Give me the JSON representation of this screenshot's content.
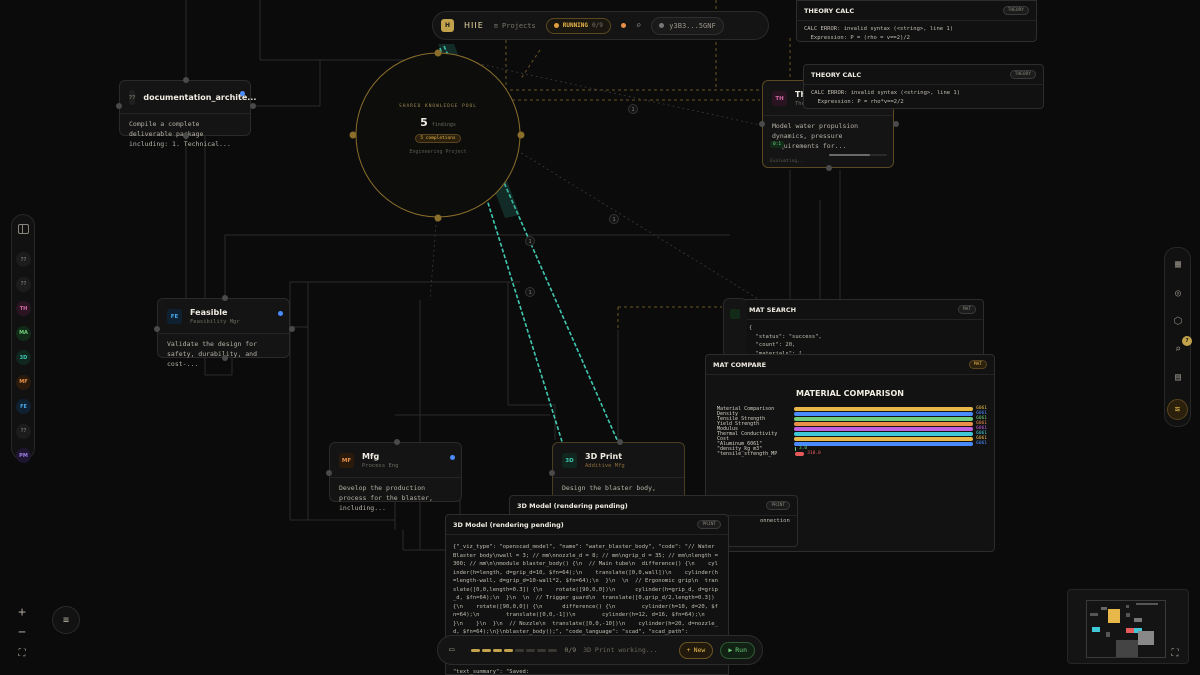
{
  "topbar": {
    "logo_letter": "H",
    "app_name": "HIIE",
    "projects_label": "Projects",
    "status_label": "RUNNING",
    "status_count": "0/9",
    "user_label": "y3B3...5GNF"
  },
  "pool": {
    "heading": "SHARED KNOWLEDGE POOL",
    "count": "5",
    "count_label": "findings",
    "completions": "5 completions",
    "project": "Engineering Project"
  },
  "nodes": {
    "documentation": {
      "badge": "??",
      "title": "documentation_archite...",
      "body": "Compile a complete deliverable package including: 1. Technical..."
    },
    "feasible": {
      "badge": "FE",
      "title": "Feasible",
      "subtitle": "Feasibility Mgr",
      "body": "Validate the design for safety, durability, and cost-..."
    },
    "mfg": {
      "badge": "MF",
      "title": "Mfg",
      "subtitle": "Process Eng",
      "body": "Develop the production process for the blaster, including..."
    },
    "print3d": {
      "badge": "3D",
      "title": "3D Print",
      "subtitle": "Additive Mfg",
      "body": "Design the blaster body, including ergonomic grip..."
    },
    "theory": {
      "badge": "TH",
      "title": "Theo",
      "subtitle": "Theo",
      "body": "Model water propulsion dynamics, pressure requirements for...",
      "tag": "0:1",
      "footer": "Evaluating..."
    }
  },
  "panels": {
    "theory_calc_1": {
      "title": "THEORY CALC",
      "tag": "THEORY",
      "line1": "CALC ERROR: invalid syntax (<string>, line 1)",
      "line2": "  Expression: P = (rho = v==2)/2"
    },
    "theory_calc_2": {
      "title": "THEORY CALC",
      "tag": "THEORY",
      "line1": "CALC ERROR: invalid syntax (<string>, line 1)",
      "line2": "  Expression: P = rho*v==2/2"
    },
    "mat_search": {
      "title": "MAT SEARCH",
      "tag": "MAT",
      "content": "{\n  \"status\": \"success\",\n  \"count\": 20,\n  \"materials\": ["
    },
    "mat_compare": {
      "title": "MAT COMPARE",
      "tag": "MAT",
      "chart_title": "MATERIAL COMPARISON"
    },
    "model_back": {
      "title": "3D Model (rendering pending)",
      "tag": "PRINT",
      "content": "onnection"
    },
    "model_front": {
      "title": "3D Model (rendering pending)",
      "tag": "PRINT",
      "content": "{\"_viz_type\": \"openscad_model\", \"name\": \"water_blaster_body\", \"code\": \"// Water Blaster body\\nwall = 3; // mm\\nnozzle_d = 8; // mm\\ngrip_d = 35; // mm\\nlength = 300; // mm\\n\\nmodule blaster_body() {\\n  // Main tube\\n  difference() {\\n    cylinder(h=length, d=grip_d=10, $fn=64);\\n    translate([0,0,wall])\\n    cylinder(h=length-wall, d=grip_d=10-wall*2, $fn=64);\\n  }\\n  \\n  // Ergonomic grip\\n  translate([0,0,length=0.3]) {\\n    rotate([90,0,0])\\n      cylinder(h=grip_d, d=grip_d, $fn=64);\\n  }\\n  \\n  // Trigger guard\\n  translate([0,grip_d/2,length=0.3]) {\\n    rotate([90,0,0]) {\\n      difference() {\\n        cylinder(h=10, d=20, $fn=64);\\n        translate([0,0,-1])\\n        cylinder(h=12, d=16, $fn=64);\\n      }\\n    }\\n  }\\n  // Nozzle\\n  translate([0,0,-10])\\n    cylinder(h=20, d=nozzle_d, $fn=64);\\n}\\nblaster_body();\", \"code_language\": \"scad\", \"scad_path\":",
      "tail": "\"text_summary\": \"Saved:"
    }
  },
  "chart_data": {
    "type": "bar",
    "title": "MATERIAL COMPARISON",
    "categories": [
      "Material Comparison",
      "Density",
      "Tensile Strength",
      "Yield Strength",
      "Modulus",
      "Thermal Conductivity",
      "Cost",
      "\"Aluminum_6061\"",
      "\"density_kg_m3\"",
      "\"tensile_strength_MP"
    ],
    "values": [
      6061,
      6061,
      6061,
      6061,
      6061,
      6061,
      6061,
      6061,
      3.0,
      310.0
    ],
    "value_labels": [
      "6061",
      "6061",
      "6061",
      "6061",
      "6061",
      "6061",
      "6061",
      "6061",
      "3.0",
      "310.0"
    ],
    "colors": [
      "#e8b74a",
      "#4a8cff",
      "#6fcf7a",
      "#e8904a",
      "#c060e0",
      "#40c8d8",
      "#e8b74a",
      "#4a8cff",
      "#6fcf7a",
      "#e85a5a"
    ],
    "xlim": [
      0,
      6061
    ]
  },
  "edge_labels": [
    "1",
    "1",
    "1",
    "1"
  ],
  "left_sidebar": [
    {
      "label": "??",
      "color": "#6f6a60",
      "bg": "#1c1c1c"
    },
    {
      "label": "??",
      "color": "#6f6a60",
      "bg": "#1c1c1c"
    },
    {
      "label": "TH",
      "color": "#d86aa8",
      "bg": "#2a1422"
    },
    {
      "label": "MA",
      "color": "#6fcf7a",
      "bg": "#122a18"
    },
    {
      "label": "3D",
      "color": "#40c8b0",
      "bg": "#10261f"
    },
    {
      "label": "MF",
      "color": "#e8904a",
      "bg": "#2a1a0c"
    },
    {
      "label": "FE",
      "color": "#4aa8e8",
      "bg": "#0f2030"
    },
    {
      "label": "??",
      "color": "#6f6a60",
      "bg": "#1c1c1c"
    },
    {
      "label": "PM",
      "color": "#a080e8",
      "bg": "#1e1630"
    }
  ],
  "right_sidebar": {
    "icons": [
      "grid-icon",
      "target-icon",
      "cube-icon",
      "search-icon",
      "document-icon",
      "wifi-icon"
    ],
    "notification_count": "7"
  },
  "bottombar": {
    "progress_text": "0/9",
    "activity_text": "3D Print working...",
    "new_label": "New",
    "run_label": "Run"
  },
  "colors": {
    "accent": "#c2a24a",
    "running": "#e8b74a",
    "teal": "#40c8b0",
    "blue_status": "#4a8cff"
  }
}
